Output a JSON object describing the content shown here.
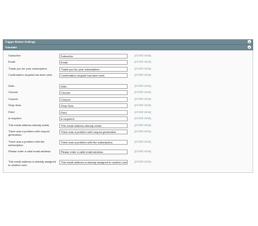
{
  "sections": {
    "trigger": {
      "title": "Trigger Button Settings"
    },
    "translate": {
      "title": "Translate"
    }
  },
  "fields": [
    {
      "label": "Subscribe",
      "value": "Subscribe",
      "scope": "[STORE VIEW]"
    },
    {
      "label": "Email",
      "value": "Email",
      "scope": "[STORE VIEW]"
    },
    {
      "label": "Thank you for your subscription.",
      "value": "Thank you for your subscription.",
      "scope": "[STORE VIEW]"
    },
    {
      "label": "Confirmation request has been sent.",
      "value": "Confirmation request has been sent.",
      "scope": "[STORE VIEW]"
    },
    {
      "label": "Wait...",
      "value": "Wait...",
      "scope": "[STORE VIEW]"
    },
    {
      "label": "Choose",
      "value": "Choose",
      "scope": "[STORE VIEW]"
    },
    {
      "label": "Coupon",
      "value": "Coupon",
      "scope": "[STORE VIEW]"
    },
    {
      "label": "Shop Now",
      "value": "Shop Now",
      "scope": "[STORE VIEW]"
    },
    {
      "label": "Field",
      "value": "Field",
      "scope": "[STORE VIEW]"
    },
    {
      "label": "is required",
      "value": "is required!",
      "scope": "[STORE VIEW]"
    },
    {
      "label": "This email address already exists",
      "value": "This email address already exists",
      "scope": "[STORE VIEW]"
    },
    {
      "label": "There was a problem with coupon generation.",
      "value": "There was a problem with coupon generation.",
      "scope": "[STORE VIEW]"
    },
    {
      "label": "There was a problem with the subscription.",
      "value": "There was a problem with the subscription.",
      "scope": "[STORE VIEW]"
    },
    {
      "label": "Please enter a valid email address.",
      "value": "Please enter a valid email address.",
      "scope": "[STORE VIEW]"
    },
    {
      "label": "This email address is already assigned to another user.",
      "value": "This email address is already assigned to another user.",
      "scope": "[STORE VIEW]"
    }
  ],
  "icons": {
    "toggle": "collapse-icon"
  }
}
